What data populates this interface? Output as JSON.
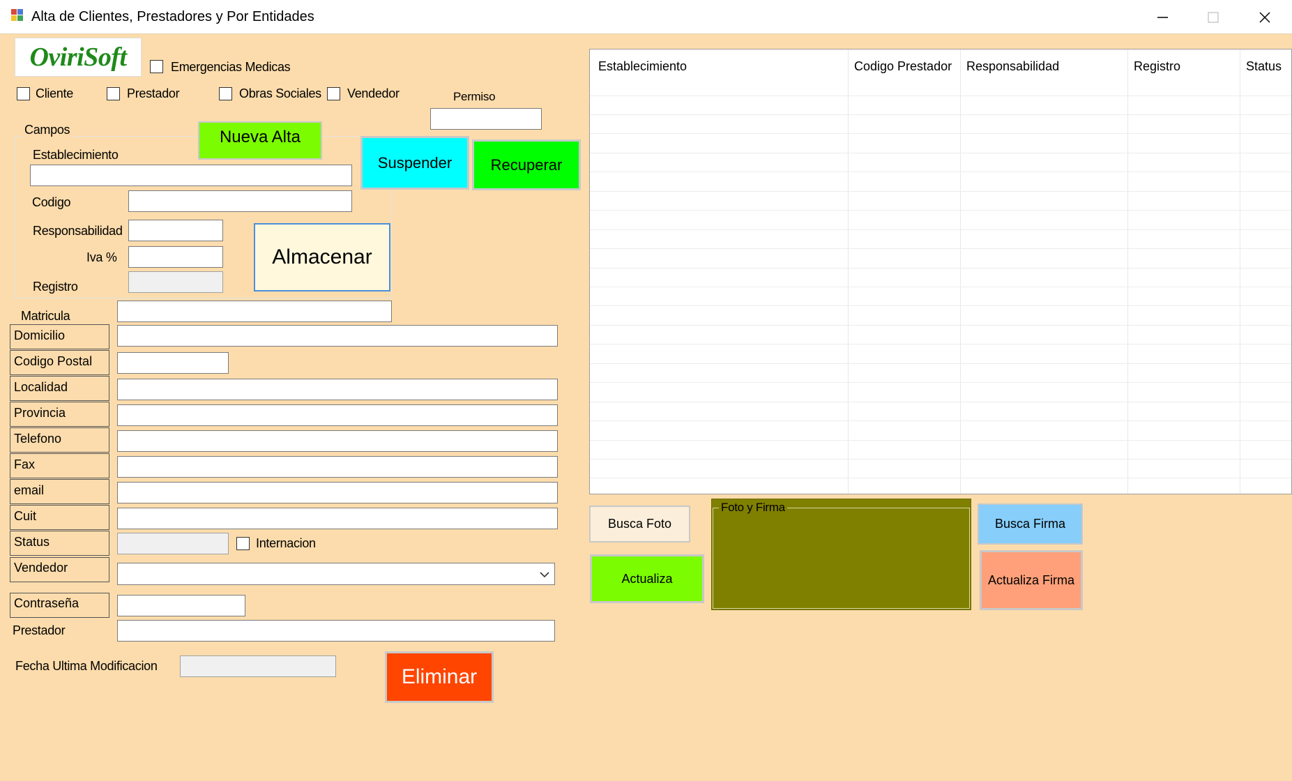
{
  "window": {
    "title": "Alta de Clientes, Prestadores y Por Entidades"
  },
  "logo": {
    "text": "OviriSoft"
  },
  "checks": {
    "emergencias": "Emergencias Medicas",
    "cliente": "Cliente",
    "prestador": "Prestador",
    "obras_sociales": "Obras Sociales",
    "vendedor": "Vendedor",
    "internacion": "Internacion"
  },
  "permiso": {
    "label": "Permiso",
    "value": ""
  },
  "campos": {
    "group_label": "Campos",
    "establecimiento_label": "Establecimiento",
    "codigo_label": "Codigo",
    "responsabilidad_label": "Responsabilidad",
    "iva_label": "Iva %",
    "registro_label": "Registro"
  },
  "buttons": {
    "nueva_alta": "Nueva Alta",
    "suspender": "Suspender",
    "recuperar": "Recuperar",
    "almacenar": "Almacenar",
    "eliminar": "Eliminar",
    "busca_foto": "Busca Foto",
    "actualiza": "Actualiza",
    "busca_firma": "Busca Firma",
    "actualiza_firma": "Actualiza Firma"
  },
  "form": {
    "matricula": "Matricula",
    "domicilio": "Domicilio",
    "codigo_postal": "Codigo Postal",
    "localidad": "Localidad",
    "provincia": "Provincia",
    "telefono": "Telefono",
    "fax": "Fax",
    "email": "email",
    "cuit": "Cuit",
    "status": "Status",
    "vendedor": "Vendedor",
    "contrasena": "Contraseña",
    "prestador": "Prestador",
    "fecha_ultima": "Fecha Ultima Modificacion"
  },
  "grid": {
    "columns": [
      "Establecimiento",
      "Codigo Prestador",
      "Responsabilidad",
      "Registro",
      "Status"
    ]
  },
  "foto_firma": {
    "label": "Foto y Firma"
  },
  "colors": {
    "background": "#fcdcac",
    "nueva_alta": "#7cfc00",
    "suspender": "#00ffff",
    "recuperar": "#00ff00",
    "almacenar": "#fff8dc",
    "eliminar": "#ff4500",
    "busca_foto": "#fbeedb",
    "actualiza": "#7cfc00",
    "busca_firma": "#87cefa",
    "actualiza_firma": "#ffa07a",
    "foto_panel": "#808000"
  },
  "icons": {
    "app": "app-icon",
    "minimize": "minimize-icon",
    "maximize": "maximize-icon",
    "close": "close-icon",
    "dropdown": "chevron-down-icon"
  }
}
